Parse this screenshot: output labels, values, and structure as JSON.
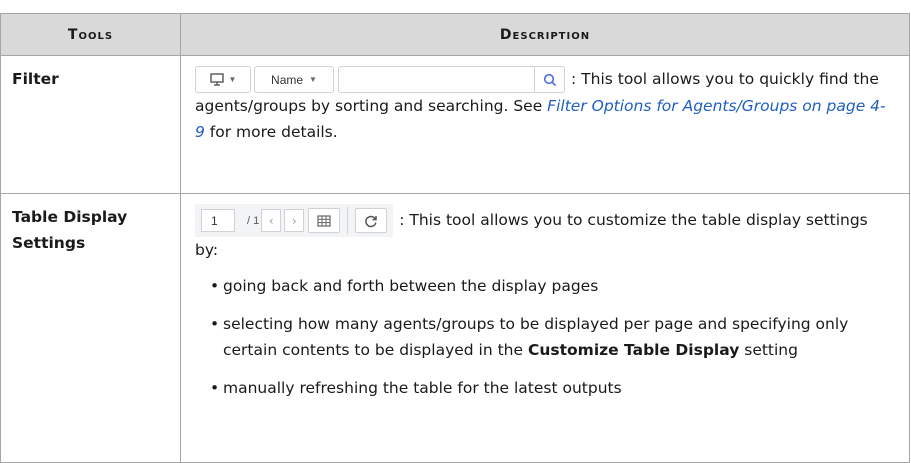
{
  "table": {
    "headers": {
      "tools": "Tools",
      "description": "Description"
    },
    "filter": {
      "name": "Filter",
      "toolbar": {
        "name_dropdown": "Name"
      },
      "text_intro": ": This tool allows you to quickly find the agents/groups by sorting and searching. See ",
      "link": "Filter Options for Agents/Groups on page 4-9",
      "text_after": " for more details."
    },
    "table_display": {
      "name": "Table Display Settings",
      "toolbar": {
        "page_value": "1",
        "page_total": "/ 1"
      },
      "text_intro": ": This tool allows you to customize the table display settings by:",
      "bullets": [
        {
          "text": "going back and forth between the display pages"
        },
        {
          "pre": "selecting how many agents/groups to be displayed per page and specifying only certain contents to be displayed in the ",
          "bold": "Customize Table Display",
          "post": " setting"
        },
        {
          "text": "manually refreshing the table for the latest outputs"
        }
      ]
    }
  },
  "colors": {
    "header_bg": "#d9d9d9",
    "border": "#a6a6a6",
    "link": "#1f5fbf",
    "search_icon": "#4a6fd8"
  }
}
